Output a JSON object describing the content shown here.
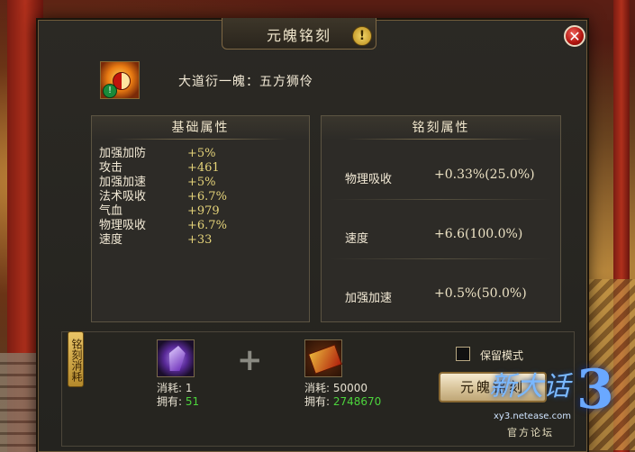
{
  "window": {
    "title": "元魄铭刻",
    "close_symbol": "✕",
    "info_symbol": "!"
  },
  "item": {
    "name": "大道衍一魄：五方狮伶",
    "badge": "!"
  },
  "basic_attrs": {
    "header": "基础属性",
    "rows": [
      {
        "name": "加强加防",
        "value": "+5%"
      },
      {
        "name": "攻击",
        "value": "+461"
      },
      {
        "name": "加强加速",
        "value": "+5%"
      },
      {
        "name": "法术吸收",
        "value": "+6.7%"
      },
      {
        "name": "气血",
        "value": "+979"
      },
      {
        "name": "物理吸收",
        "value": "+6.7%"
      },
      {
        "name": "速度",
        "value": "+33"
      }
    ]
  },
  "inscription_attrs": {
    "header": "铭刻属性",
    "rows": [
      {
        "name": "物理吸收",
        "value": "+0.33%(25.0%)"
      },
      {
        "name": "速度",
        "value": "+6.6(100.0%)"
      },
      {
        "name": "加强加速",
        "value": "+0.5%(50.0%)"
      }
    ]
  },
  "cost_section": {
    "side_label": "铭刻消耗",
    "plus": "+",
    "materials": [
      {
        "icon": "purple-gem-icon",
        "cost_label": "消耗:",
        "cost": "1",
        "own_label": "拥有:",
        "own": "51"
      },
      {
        "icon": "scroll-book-icon",
        "cost_label": "消耗:",
        "cost": "50000",
        "own_label": "拥有:",
        "own": "2748670"
      }
    ],
    "keep_mode_label": "保留模式",
    "keep_mode_checked": false,
    "inscribe_button": "元魄铭刻"
  },
  "watermark": {
    "logo": "新大话",
    "digit": "3",
    "url": "xy3.netease.com",
    "sub": "官方论坛"
  },
  "colors": {
    "value_yellow": "#e6d47a",
    "owned_green": "#4cd43c",
    "close_red": "#b0140e"
  }
}
